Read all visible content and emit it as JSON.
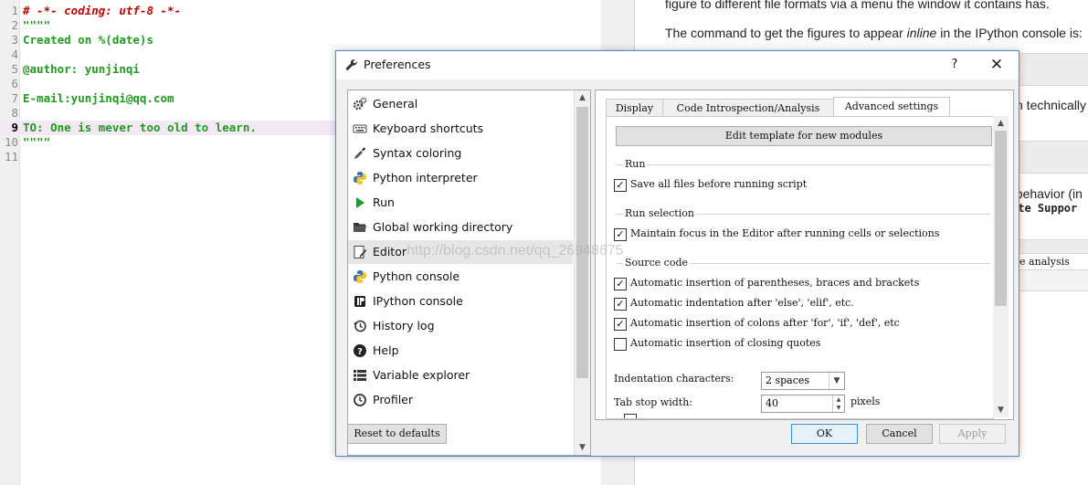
{
  "editor": {
    "lines": [
      {
        "num": "1",
        "text": "# -*- coding: utf-8 -*-"
      },
      {
        "num": "2",
        "text": "\"\"\"\""
      },
      {
        "num": "3",
        "text": "Created on %(date)s"
      },
      {
        "num": "4",
        "text": ""
      },
      {
        "num": "5",
        "text": "@author: yunjinqi"
      },
      {
        "num": "6",
        "text": ""
      },
      {
        "num": "7",
        "text": "E-mail:yunjinqi@qq.com"
      },
      {
        "num": "8",
        "text": ""
      },
      {
        "num": "9",
        "text": "TO: One is mever too old to learn."
      },
      {
        "num": "10",
        "text": "\"\"\"\""
      },
      {
        "num": "11",
        "text": ""
      }
    ]
  },
  "doc": {
    "line1": "figure to different file formats via a menu the window it contains has.",
    "line2_a": "The command to get the figures to appear ",
    "line2_em": "inline",
    "line2_b": " in the IPython console is:",
    "frag1": "h technically",
    "frag2": "t behavior (in",
    "frag3": "ate Suppor",
    "frag4": "de analysis"
  },
  "dialog": {
    "title": "Preferences",
    "help": "?",
    "close": "✕",
    "icon": "wrench-icon",
    "categories": [
      {
        "label": "General",
        "icon": "gears-icon"
      },
      {
        "label": "Keyboard shortcuts",
        "icon": "keyboard-icon"
      },
      {
        "label": "Syntax coloring",
        "icon": "eyedropper-icon"
      },
      {
        "label": "Python interpreter",
        "icon": "python-icon"
      },
      {
        "label": "Run",
        "icon": "run-icon"
      },
      {
        "label": "Global working directory",
        "icon": "folder-icon"
      },
      {
        "label": "Editor",
        "icon": "editor-icon"
      },
      {
        "label": "Python console",
        "icon": "python-icon"
      },
      {
        "label": "IPython console",
        "icon": "ipython-icon"
      },
      {
        "label": "History log",
        "icon": "history-icon"
      },
      {
        "label": "Help",
        "icon": "help-icon"
      },
      {
        "label": "Variable explorer",
        "icon": "list-icon"
      },
      {
        "label": "Profiler",
        "icon": "clock-icon"
      }
    ],
    "selected_category": "Editor",
    "reset_label": "Reset to defaults",
    "tabs": [
      "Display",
      "Code Introspection/Analysis",
      "Advanced settings"
    ],
    "active_tab": "Advanced settings",
    "template_button": "Edit template for new modules",
    "run_group": "Run",
    "run_opt": "Save all files before running script",
    "runsel_group": "Run selection",
    "runsel_opt": "Maintain focus in the Editor after running cells or selections",
    "source_group": "Source code",
    "src_opt1": "Automatic insertion of parentheses, braces and brackets",
    "src_opt2": "Automatic indentation after 'else', 'elif', etc.",
    "src_opt3": "Automatic insertion of colons after 'for', 'if', 'def', etc",
    "src_opt4": "Automatic insertion of closing quotes",
    "indent_label": "Indentation characters:",
    "indent_value": "2 spaces",
    "tabstop_label": "Tab stop width:",
    "tabstop_value": "40",
    "tabstop_units": "pixels",
    "ok": "OK",
    "cancel": "Cancel",
    "apply": "Apply"
  },
  "watermark": "http://blog.csdn.net/qq_26948675"
}
